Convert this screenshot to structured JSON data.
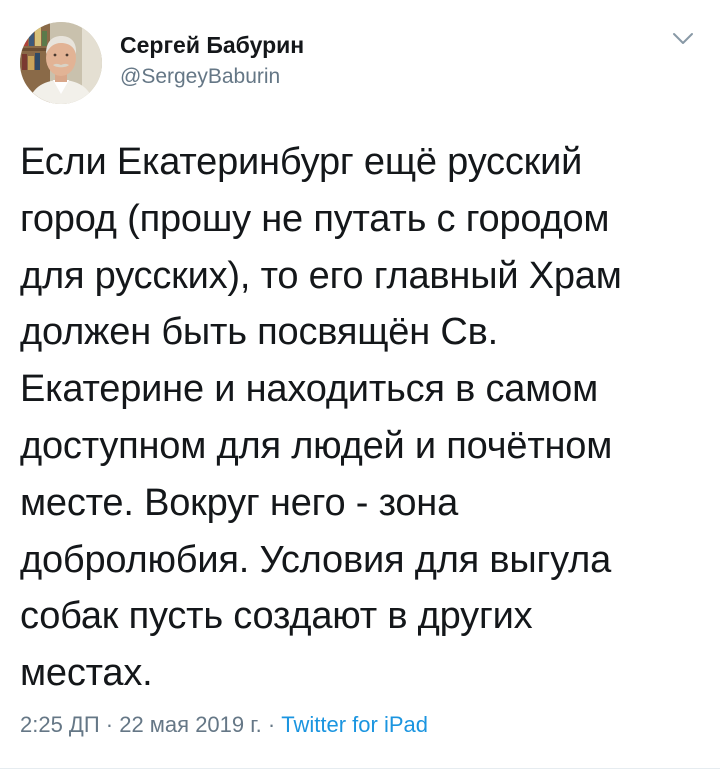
{
  "author": {
    "display_name": "Сергей Бабурин",
    "handle": "@SergeyBaburin"
  },
  "tweet": {
    "text": "Если Екатеринбург ещё русский\nгород (прошу не путать с городом\nдля русских), то его главный Храм\nдолжен быть посвящён Св.\nЕкатерине и находиться в самом\nдоступном для людей и почётном\nместе. Вокруг него - зона\nдобролюбия. Условия для выгула\nсобак пусть создают в других\nместах.",
    "time": "2:25 ДП",
    "date": "22 мая 2019 г.",
    "source": "Twitter for iPad",
    "separator": " · "
  },
  "icons": {
    "caret": "chevron-down-icon",
    "avatar": "avatar-photo"
  },
  "colors": {
    "text": "#14171a",
    "secondary": "#657786",
    "link": "#1b95e0"
  }
}
